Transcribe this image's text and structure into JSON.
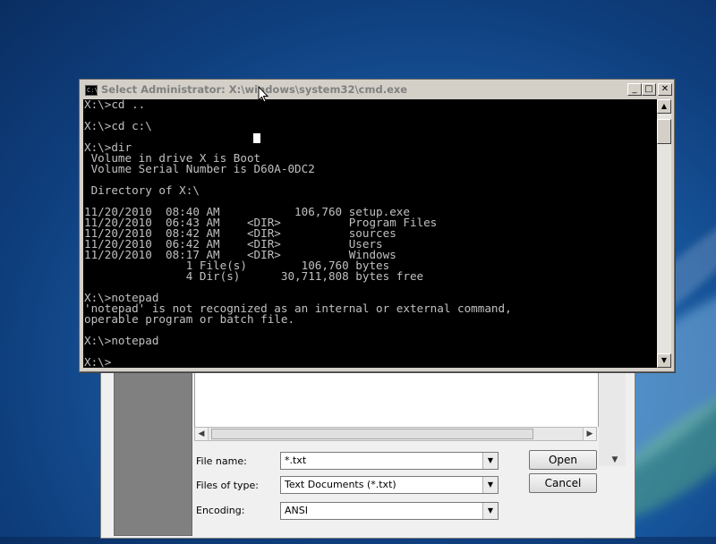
{
  "cmd_window": {
    "title": "Select Administrator: X:\\windows\\system32\\cmd.exe",
    "icon_label": "C:\\",
    "controls": {
      "minimize": "_",
      "maximize": "□",
      "close": "✕"
    },
    "console_lines": [
      "X:\\>cd ..",
      "",
      "X:\\>cd c:\\",
      "",
      "X:\\>dir",
      " Volume in drive X is Boot",
      " Volume Serial Number is D60A-0DC2",
      "",
      " Directory of X:\\",
      "",
      "11/20/2010  08:40 AM           106,760 setup.exe",
      "11/20/2010  06:43 AM    <DIR>          Program Files",
      "11/20/2010  08:42 AM    <DIR>          sources",
      "11/20/2010  06:42 AM    <DIR>          Users",
      "11/20/2010  08:17 AM    <DIR>          Windows",
      "               1 File(s)        106,760 bytes",
      "               4 Dir(s)      30,711,808 bytes free",
      "",
      "X:\\>notepad",
      "'notepad' is not recognized as an internal or external command,",
      "operable program or batch file.",
      "",
      "X:\\>notepad",
      "",
      "X:\\>"
    ]
  },
  "open_dialog": {
    "file_name_label": "File name:",
    "file_name_value": "*.txt",
    "files_of_type_label": "Files of type:",
    "files_of_type_value": "Text Documents (*.txt)",
    "encoding_label": "Encoding:",
    "encoding_value": "ANSI",
    "open_button": "Open",
    "cancel_button": "Cancel"
  },
  "icons": {
    "cmd_icon": "console-icon",
    "pointer": "mouse-pointer-icon",
    "dropdown": "chevron-down-icon"
  },
  "colors": {
    "console_bg": "#000000",
    "console_text": "#c0c0c0",
    "desktop": "#1a5fa8"
  }
}
